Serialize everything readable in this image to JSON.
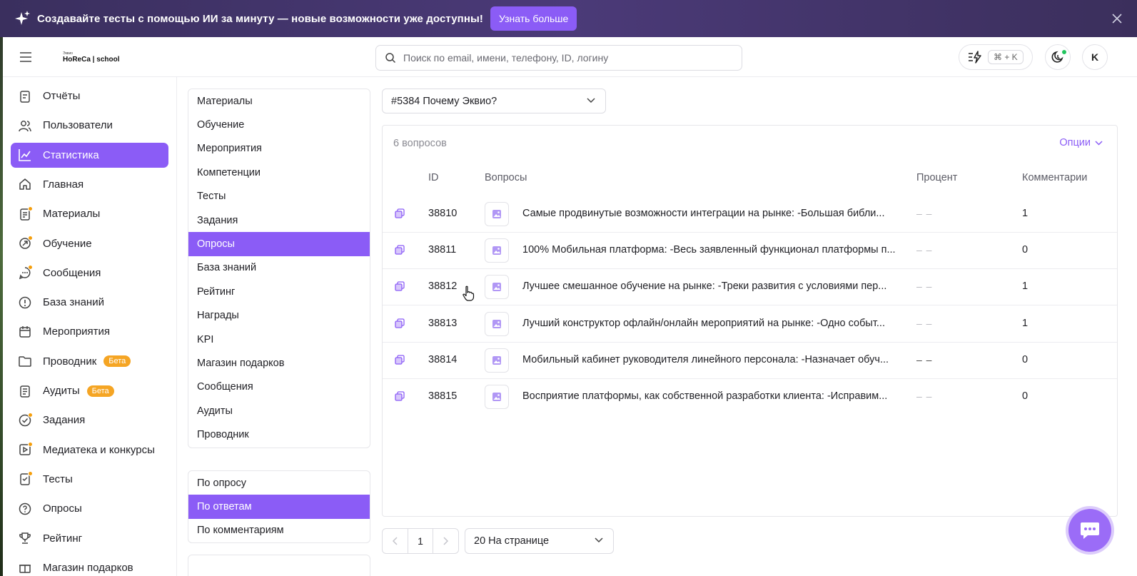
{
  "banner": {
    "text": "Создавайте тесты с помощью ИИ за минуту — новые возможности уже доступны!",
    "button": "Узнать больше"
  },
  "header": {
    "logo_small": "Эквио",
    "logo_text": "HoReCa | school",
    "search_placeholder": "Поиск по email, имени, телефону, ID, логину",
    "shortcut": "⌘ + K",
    "avatar_initial": "K"
  },
  "sidebar": {
    "items": [
      {
        "label": "Отчёты",
        "icon": "report-icon"
      },
      {
        "label": "Пользователи",
        "icon": "users-icon"
      },
      {
        "label": "Статистика",
        "icon": "chart-icon",
        "active": true
      },
      {
        "label": "Главная",
        "icon": "home-icon"
      },
      {
        "label": "Материалы",
        "icon": "materials-icon",
        "dot": true
      },
      {
        "label": "Обучение",
        "icon": "learning-icon",
        "dot": true
      },
      {
        "label": "Сообщения",
        "icon": "messages-icon",
        "dot": true
      },
      {
        "label": "База знаний",
        "icon": "knowledge-icon"
      },
      {
        "label": "Мероприятия",
        "icon": "calendar-icon"
      },
      {
        "label": "Проводник",
        "icon": "folder-icon",
        "badge": "Бета"
      },
      {
        "label": "Аудиты",
        "icon": "audit-icon",
        "badge": "Бета"
      },
      {
        "label": "Задания",
        "icon": "tasks-icon",
        "dot": true
      },
      {
        "label": "Медиатека и конкурсы",
        "icon": "media-icon",
        "dot": true
      },
      {
        "label": "Тесты",
        "icon": "tests-icon",
        "dot": true
      },
      {
        "label": "Опросы",
        "icon": "surveys-icon"
      },
      {
        "label": "Рейтинг",
        "icon": "trophy-icon"
      },
      {
        "label": "Магазин подарков",
        "icon": "gift-icon"
      }
    ]
  },
  "section_menu": {
    "items": [
      "Материалы",
      "Обучение",
      "Мероприятия",
      "Компетенции",
      "Тесты",
      "Задания",
      "Опросы",
      "База знаний",
      "Рейтинг",
      "Награды",
      "KPI",
      "Магазин подарков",
      "Сообщения",
      "Аудиты",
      "Проводник"
    ],
    "active_index": 6
  },
  "view_menu": {
    "items": [
      "По опросу",
      "По ответам",
      "По комментариям"
    ],
    "active_index": 1
  },
  "survey_select": {
    "value": "#5384 Почему Эквио?"
  },
  "table": {
    "count": "6 вопросов",
    "options": "Опции",
    "headers": {
      "id": "ID",
      "question": "Вопросы",
      "percent": "Процент",
      "comments": "Комментарии"
    },
    "rows": [
      {
        "id": "38810",
        "question": "Самые продвинутые возможности интеграции на рынке: -Большая библи...",
        "percent": "– –",
        "comments": "1"
      },
      {
        "id": "38811",
        "question": "100% Мобильная платформа: -Весь заявленный функционал платформы п...",
        "percent": "– –",
        "comments": "0"
      },
      {
        "id": "38812",
        "question": "Лучшее смешанное обучение на рынке: -Треки развития с условиями пер...",
        "percent": "– –",
        "comments": "1"
      },
      {
        "id": "38813",
        "question": "Лучший конструктор офлайн/онлайн мероприятий на рынке: -Одно событ...",
        "percent": "– –",
        "comments": "1"
      },
      {
        "id": "38814",
        "question": "Мобильный кабинет руководителя линейного персонала: -Назначает обуч...",
        "percent": "– –",
        "comments": "0"
      },
      {
        "id": "38815",
        "question": "Восприятие платформы, как собственной разработки клиента: -Исправим...",
        "percent": "– –",
        "comments": "0"
      }
    ]
  },
  "pagination": {
    "page": "1",
    "per_page": "20 На странице"
  },
  "colors": {
    "accent": "#8b5cf6",
    "banner": "#3f3368",
    "badge": "#f5a524",
    "dot": "#f59e0b"
  }
}
